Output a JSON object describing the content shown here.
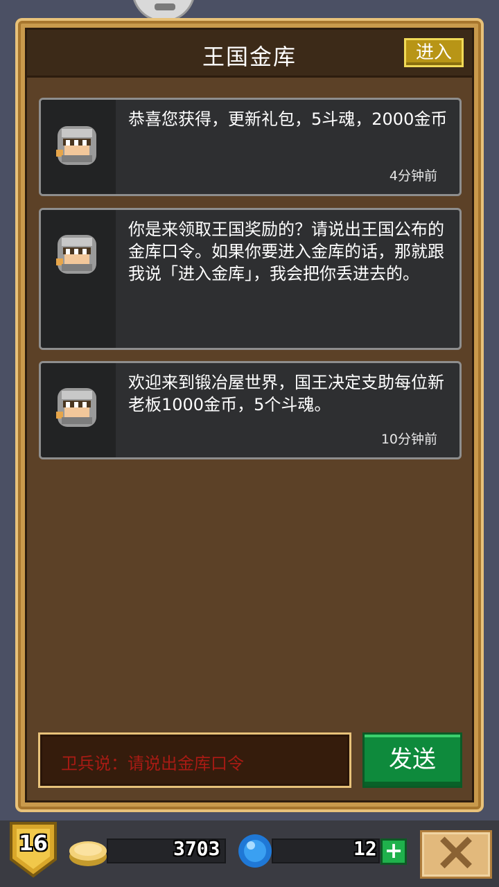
{
  "panel": {
    "title": "王国金库",
    "enter_label": "进入"
  },
  "messages": [
    {
      "text": "恭喜您获得，更新礼包，5斗魂，2000金币",
      "time": "4分钟前"
    },
    {
      "text": "你是来领取王国奖励的？请说出王国公布的金库口令。如果你要进入金库的话，那就跟我说「进入金库」，我会把你丢进去的。",
      "time": ""
    },
    {
      "text": "欢迎来到锻冶屋世界，国王决定支助每位新老板1000金币，5个斗魂。",
      "time": "10分钟前"
    }
  ],
  "input": {
    "placeholder": "卫兵说：请说出金库口令"
  },
  "send_label": "发送",
  "status": {
    "level": "16",
    "coins": "3703",
    "gems": "12"
  },
  "icons": {
    "level": "shield-badge-icon",
    "coins": "gold-coin-icon",
    "gems": "blue-gem-icon",
    "add": "plus-icon",
    "close": "close-x-icon",
    "avatar": "knight-helmet-icon"
  },
  "colors": {
    "panel_bg": "#5c4127",
    "send_green": "#0e8a3c",
    "enter_gold": "#b89516",
    "placeholder_red": "#a81b14"
  }
}
